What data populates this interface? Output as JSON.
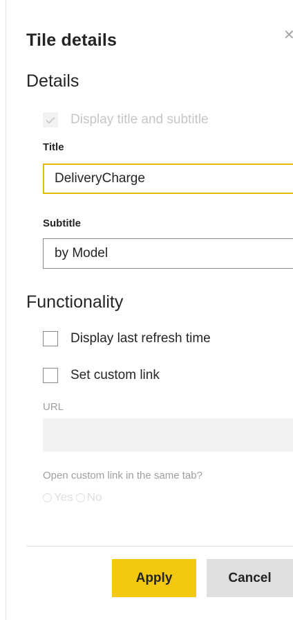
{
  "panel": {
    "title": "Tile details",
    "close_icon": "close-icon"
  },
  "details": {
    "heading": "Details",
    "display_title_checkbox": {
      "label": "Display title and subtitle",
      "checked": true,
      "disabled": true
    },
    "title_field": {
      "label": "Title",
      "value": "DeliveryCharge"
    },
    "subtitle_field": {
      "label": "Subtitle",
      "value": "by Model"
    }
  },
  "functionality": {
    "heading": "Functionality",
    "refresh_checkbox": {
      "label": "Display last refresh time",
      "checked": false
    },
    "custom_link_checkbox": {
      "label": "Set custom link",
      "checked": false
    },
    "url_field": {
      "label": "URL",
      "value": ""
    },
    "same_tab": {
      "question": "Open custom link in the same tab?",
      "options": [
        "Yes",
        "No"
      ]
    }
  },
  "footer": {
    "apply_label": "Apply",
    "cancel_label": "Cancel"
  },
  "colors": {
    "accent": "#f2c811",
    "focus_border": "#e6b800",
    "cancel_bg": "#e1dfdd"
  }
}
